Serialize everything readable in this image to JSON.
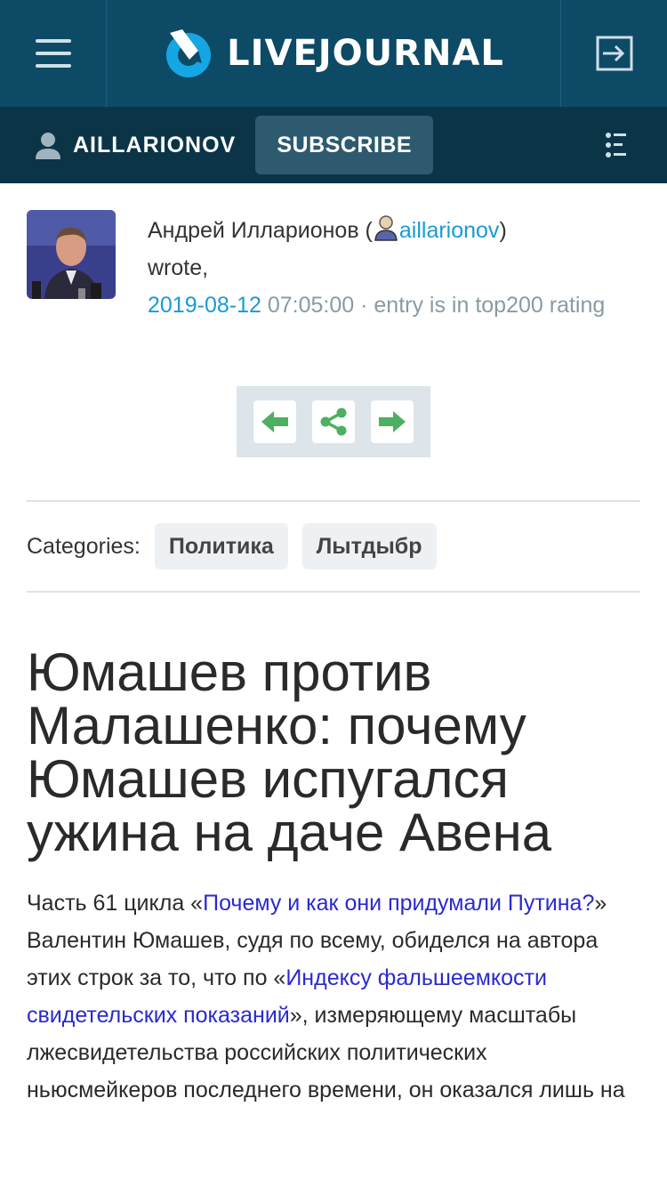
{
  "header": {
    "logo_text": "LIVEJOURNAL",
    "menu_icon": "hamburger-menu-icon",
    "login_icon": "login-icon",
    "brand_color": "#0d4a66"
  },
  "userbar": {
    "username": "AILLARIONOV",
    "subscribe_label": "SUBSCRIBE",
    "filter_icon": "filter-list-icon"
  },
  "post": {
    "author_name": "Андрей Илларионов (",
    "author_user": "aillarionov",
    "author_close": ")",
    "wrote": "wrote,",
    "date": "2019-08-12",
    "time": "07:05:00",
    "separator": "·",
    "rating_note": "entry is in top200 rating"
  },
  "categories": {
    "label": "Categories:",
    "items": [
      "Политика",
      "Лытдыбр"
    ]
  },
  "article": {
    "title": "Юмашев против Малашенко: почему Юмашев испугался ужина на даче Авена",
    "p1_prefix": "Часть 61 цикла «",
    "p1_link": "Почему и как они придумали Путина?",
    "p1_suffix": "»",
    "p2_prefix": "Валентин Юмашев, судя по всему, обиделся на автора этих строк за то, что по «",
    "p2_link": "Индексу фальшеемкости свидетельских показаний",
    "p2_suffix": "», измеряющему масштабы лжесвидетельства российских политических ньюсмейкеров последнего времени, он оказался лишь на"
  }
}
